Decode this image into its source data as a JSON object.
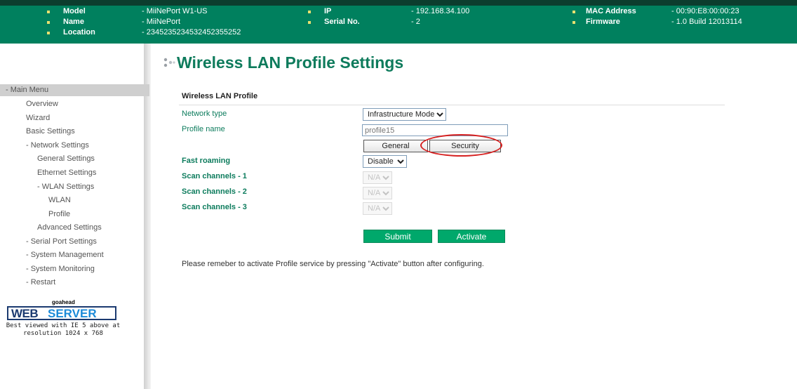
{
  "header": {
    "labels": [
      "Model",
      "Name",
      "Location",
      "IP",
      "Serial No.",
      "MAC Address",
      "Firmware"
    ],
    "model": "- MiiNePort W1-US",
    "name": "- MiiNePort",
    "location": "- 2345235234532452355252",
    "ip": "- 192.168.34.100",
    "serial": "- 2",
    "mac": "- 00:90:E8:00:00:23",
    "firmware": "- 1.0 Build 12013114",
    "bg_color": "#00805e",
    "bullet_color": "#e8e070"
  },
  "sidebar": {
    "menu_head": "- Main Menu",
    "items": [
      "Overview",
      "Wizard",
      "Basic Settings",
      "- Network Settings",
      "General Settings",
      "Ethernet Settings",
      "- WLAN Settings",
      "WLAN",
      "Profile",
      "Advanced Settings",
      "- Serial Port Settings",
      "- System Management",
      "- System Monitoring",
      "- Restart"
    ],
    "logo_top": "goahead",
    "logo_web": "WEB",
    "logo_server": "SERVER",
    "logo_note_1": "Best viewed with IE 5 above at",
    "logo_note_2": "resolution 1024 x 768"
  },
  "main": {
    "title": "Wireless LAN Profile Settings",
    "section": "Wireless LAN Profile",
    "fields": {
      "network_type_label": "Network type",
      "network_type_value": "Infrastructure Mode",
      "profile_name_label": "Profile name",
      "profile_name_placeholder": "profile15",
      "general_btn": "General",
      "security_btn": "Security",
      "fast_roaming_label": "Fast roaming",
      "fast_roaming_value": "Disable",
      "scan1_label": "Scan channels - 1",
      "scan2_label": "Scan channels - 2",
      "scan3_label": "Scan channels - 3",
      "scan_value": "N/A"
    },
    "submit": "Submit",
    "activate": "Activate",
    "note": "Please remeber to activate Profile service by pressing \"Activate\" button after configuring.",
    "accent_color": "#0e7b5c",
    "highlight_color": "#d62020"
  }
}
